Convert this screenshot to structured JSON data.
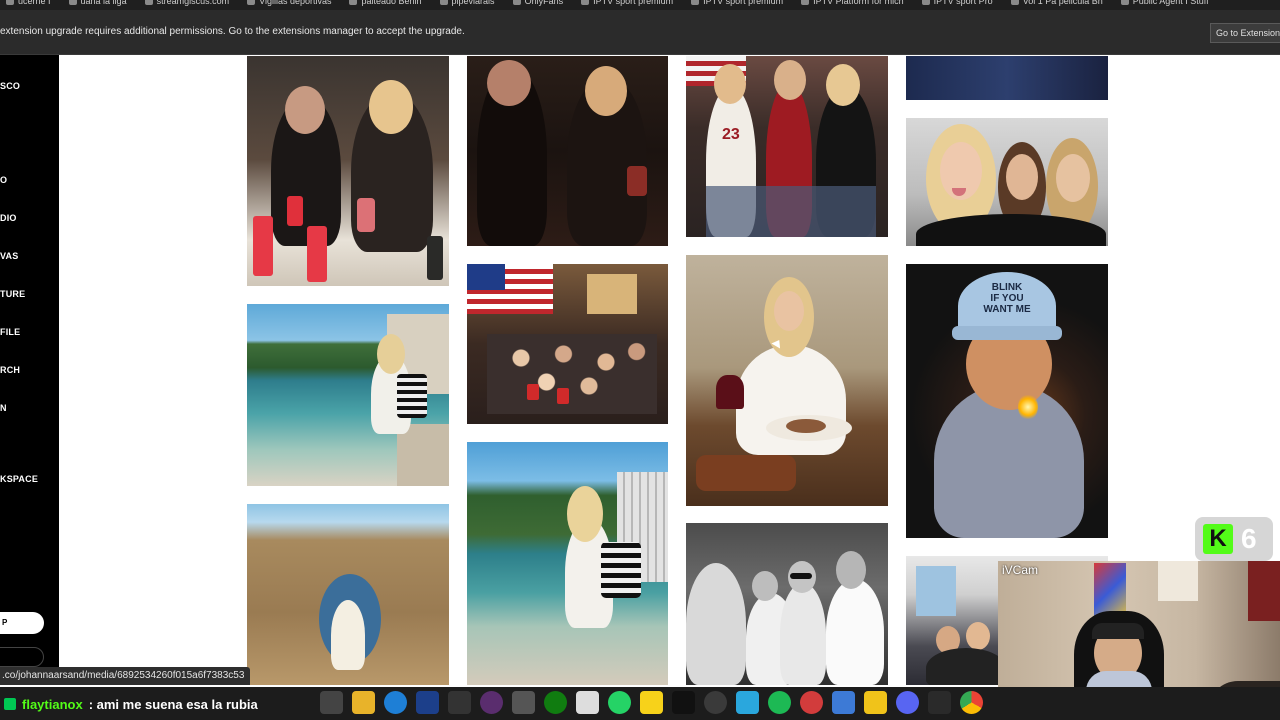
{
  "browser": {
    "bookmarks": [
      "ucerne I",
      "uana la liga",
      "streamgiscus.com",
      "Vigilias deportivas",
      "palteado Berlin",
      "pipeviarals",
      "OnlyFans",
      "IPTV sport premium",
      "IPTV sport premium",
      "IPTV Platform for mich",
      "IPTV sport Pro",
      "Vol 1 Pa pelicula Bn",
      "Public Agent I Stuff"
    ],
    "infobar": {
      "message": "extension upgrade requires additional permissions. Go to the extensions manager to accept the upgrade.",
      "button_label": "Go to Extensions"
    },
    "status_url": ".co/johannaarsand/media/6892534260f015a6f7383c53"
  },
  "sidebar": {
    "items": [
      "SCO",
      "O",
      "DIO",
      "VAS",
      "TURE",
      "FILE",
      "RCH",
      "N",
      "KSPACE"
    ],
    "pill_label": "P"
  },
  "gallery": {
    "photos": [
      {
        "id": "c1-1",
        "subject": "two women at restaurant table with pink drinks"
      },
      {
        "id": "c1-2",
        "subject": "woman walking along seaside path"
      },
      {
        "id": "c1-3",
        "subject": "person inside rock arch by the sea"
      },
      {
        "id": "c2-1",
        "subject": "women in dim bar"
      },
      {
        "id": "c2-2",
        "subject": "large group at party with american flag"
      },
      {
        "id": "c2-3",
        "subject": "woman walking on beach with striped bag"
      },
      {
        "id": "c3-1",
        "subject": "friends in jerseys posing"
      },
      {
        "id": "c3-2",
        "subject": "woman with red wine at dinner"
      },
      {
        "id": "c3-3",
        "subject": "black and white photo of young men"
      },
      {
        "id": "c4-1",
        "subject": "photo top crop dark"
      },
      {
        "id": "c4-2",
        "subject": "three friends selfie"
      },
      {
        "id": "c4-3",
        "subject": "woman in blink cap lighting a lighter"
      },
      {
        "id": "c4-4",
        "subject": "group of friends indoors"
      }
    ],
    "cap_text": [
      "BLINK",
      "IF YOU",
      "WANT ME"
    ]
  },
  "overlay": {
    "kick_count": "6",
    "cam_label": "iVCam",
    "chat": {
      "username": "flaytianox",
      "message": ": ami me suena esa la rubia"
    }
  },
  "taskbar": {
    "icons": [
      "task-view",
      "file-explorer",
      "edge",
      "photoshop",
      "epic",
      "steam",
      "calculator",
      "xbox",
      "notepad",
      "whatsapp",
      "sticky",
      "tiktok",
      "chrome-dev",
      "word-f",
      "spotify",
      "discord-red",
      "ivcam",
      "warning",
      "discord",
      "epic-games",
      "chrome"
    ]
  }
}
